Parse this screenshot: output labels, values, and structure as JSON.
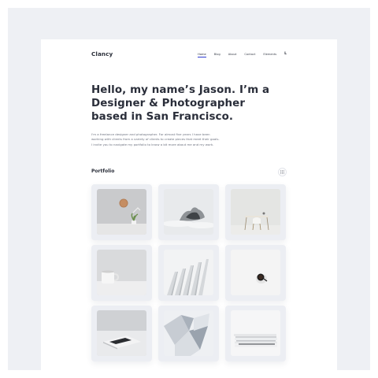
{
  "brand": {
    "name": "Clancy"
  },
  "nav": {
    "items": [
      "Home",
      "Blog",
      "About",
      "Contact",
      "Elements"
    ],
    "active": "Home",
    "extra": "L"
  },
  "hero": {
    "title": "Hello, my name’s Jason. I’m a\nDesigner & Photographer\nbased in San Francisco.",
    "intro": "I'm a freelance designer and photographer. For almost five years I have been\nworking with clients from a variety of clients to create pieces that meet their goals.\nI invite you to navigate my portfolio to know a bit more about me and my work."
  },
  "portfolio": {
    "title": "Portfolio",
    "view_toggle_icon": "grid-dots-icon",
    "items": [
      {
        "subject": "wall-clock-and-plant"
      },
      {
        "subject": "misty-rock-formation"
      },
      {
        "subject": "white-desk-and-chair"
      },
      {
        "subject": "white-mug"
      },
      {
        "subject": "white-architecture-fins"
      },
      {
        "subject": "coffee-cup-top-view"
      },
      {
        "subject": "laptop-on-desk"
      },
      {
        "subject": "white-geometric-building"
      },
      {
        "subject": "stacked-papers"
      }
    ]
  },
  "colors": {
    "accent": "#2d3bd0",
    "text_dark": "#2a2e3a",
    "text_muted": "#6e7380",
    "backdrop": "#eef0f4",
    "tile": "#eceef3"
  }
}
